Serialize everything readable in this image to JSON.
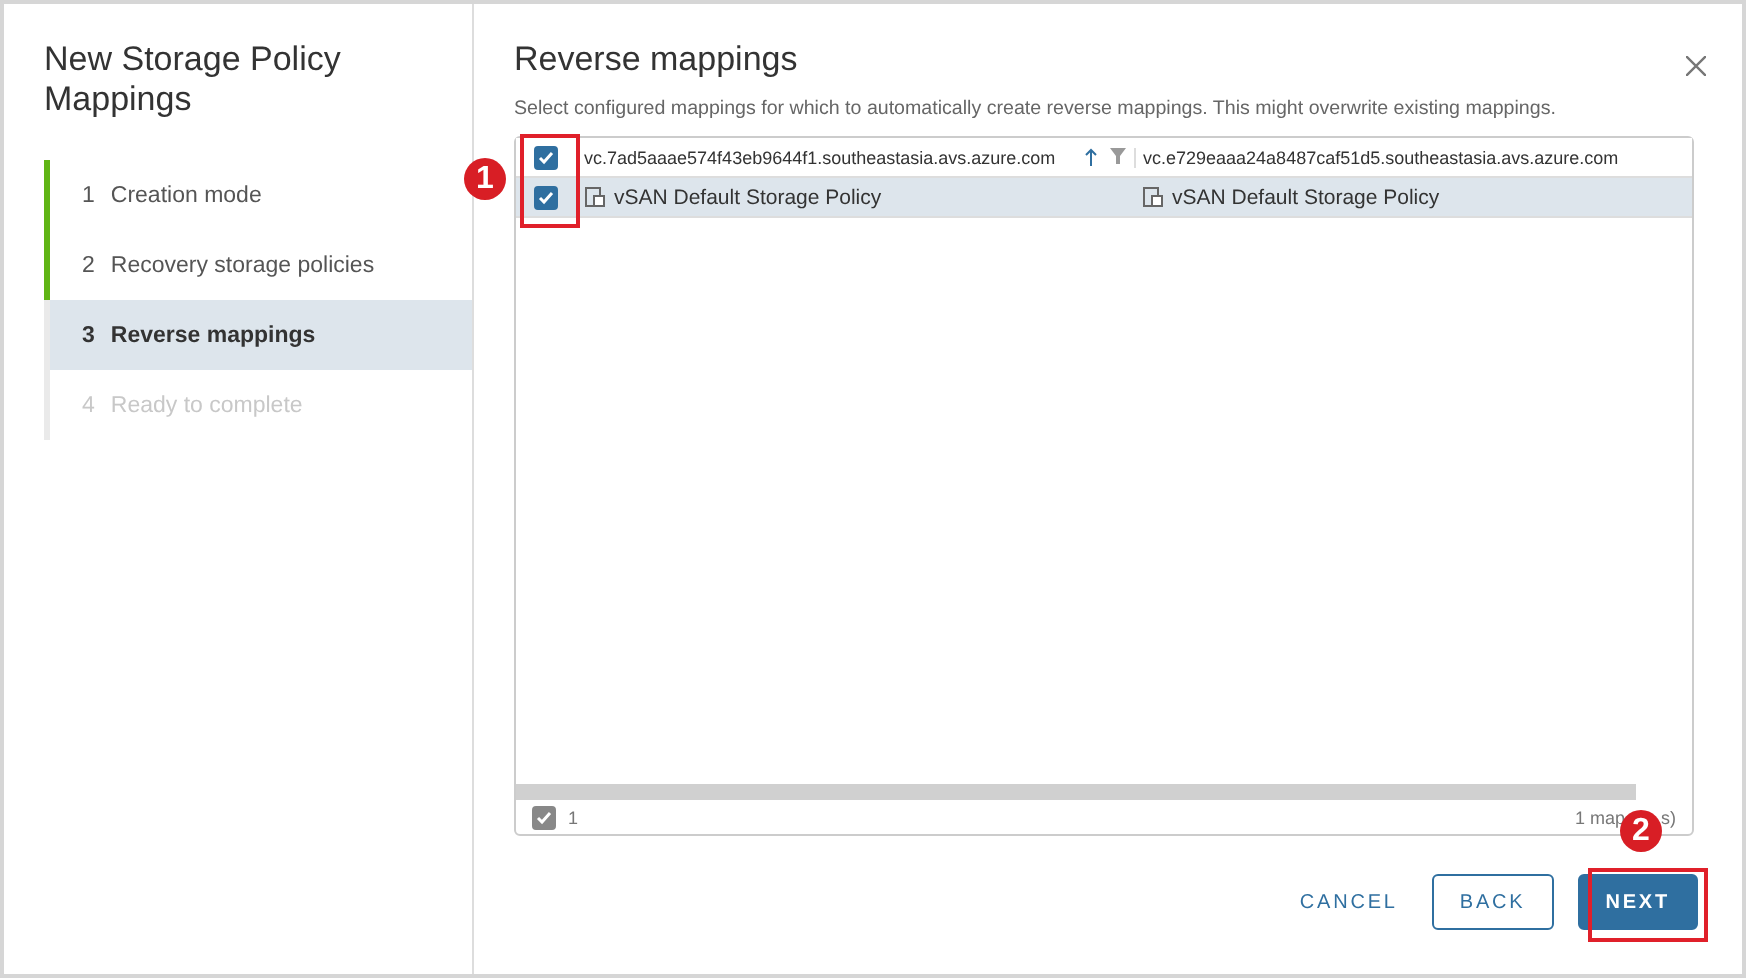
{
  "wizard": {
    "title": "New Storage Policy Mappings",
    "steps": [
      {
        "number": "1",
        "label": "Creation mode",
        "completed": true,
        "selected": false,
        "disabled": false
      },
      {
        "number": "2",
        "label": "Recovery storage policies",
        "completed": true,
        "selected": false,
        "disabled": false
      },
      {
        "number": "3",
        "label": "Reverse mappings",
        "completed": false,
        "selected": true,
        "disabled": false
      },
      {
        "number": "4",
        "label": "Ready to complete",
        "completed": false,
        "selected": false,
        "disabled": true
      }
    ]
  },
  "page": {
    "title": "Reverse mappings",
    "description": "Select configured mappings for which to automatically create reverse mappings. This might overwrite existing mappings."
  },
  "table": {
    "select_all": {
      "checked": true
    },
    "columns": [
      {
        "label": "vc.7ad5aaae574f43eb9644f1.southeastasia.avs.azure.com",
        "sorted": true,
        "filter": true
      },
      {
        "label": "vc.e729eaaa24a8487caf51d5.southeastasia.avs.azure.com",
        "sorted": false,
        "filter": false
      }
    ],
    "rows": [
      {
        "checked": true,
        "selected": true,
        "cells": [
          "vSAN Default Storage Policy",
          "vSAN Default Storage Policy"
        ]
      }
    ],
    "footer": {
      "selection_checked": true,
      "selected_count": "1",
      "total_parts": [
        "1 map",
        "s)"
      ]
    }
  },
  "buttons": [
    {
      "label": "CANCEL",
      "kind": "link"
    },
    {
      "label": "BACK",
      "kind": "outline"
    },
    {
      "label": "NEXT",
      "kind": "primary"
    }
  ],
  "callouts": [
    {
      "label": "1",
      "kind": "checkboxes"
    },
    {
      "label": "2",
      "kind": "next"
    }
  ]
}
